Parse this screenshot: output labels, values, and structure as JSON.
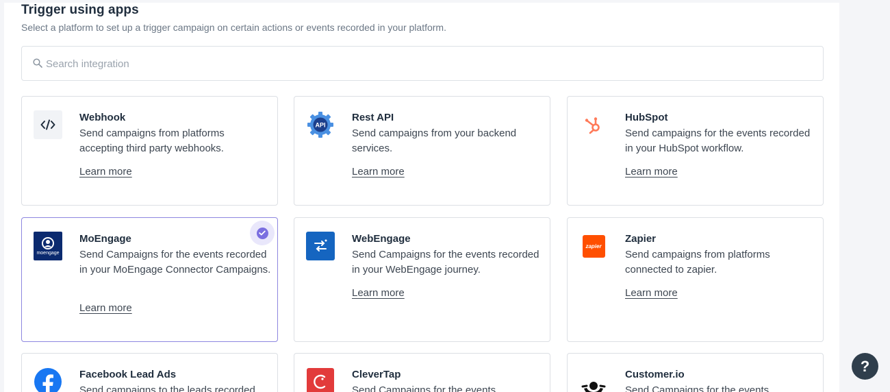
{
  "header": {
    "title": "Trigger using apps",
    "subtitle": "Select a platform to set up a trigger campaign on certain actions or events recorded in your platform."
  },
  "search": {
    "placeholder": "Search integration",
    "icon": "search-icon"
  },
  "cards": [
    {
      "name": "Webhook",
      "desc": "Send campaigns from platforms accepting third party webhooks.",
      "link": "Learn more",
      "icon": "code-icon",
      "selected": false
    },
    {
      "name": "Rest API",
      "desc": "Send campaigns from your backend services.",
      "link": "Learn more",
      "icon": "api-gear-icon",
      "selected": false
    },
    {
      "name": "HubSpot",
      "desc": "Send campaigns for the events recorded in your HubSpot workflow.",
      "link": "Learn more",
      "icon": "hubspot-icon",
      "selected": false
    },
    {
      "name": "MoEngage",
      "desc": "Send Campaigns for the events recorded in your MoEngage Connector Campaigns.",
      "link": "Learn more",
      "icon": "moengage-logo",
      "logo_text": "moengage",
      "selected": true
    },
    {
      "name": "WebEngage",
      "desc": "Send Campaigns for the events recorded in your WebEngage journey.",
      "link": "Learn more",
      "icon": "webengage-logo",
      "selected": false
    },
    {
      "name": "Zapier",
      "desc": "Send campaigns from platforms connected to zapier.",
      "link": "Learn more",
      "icon": "zapier-logo",
      "logo_text": "zapier",
      "selected": false
    },
    {
      "name": "Facebook Lead Ads",
      "desc": "Send campaigns to the leads recorded",
      "icon": "facebook-icon",
      "selected": false
    },
    {
      "name": "CleverTap",
      "desc": "Send Campaigns for the events",
      "icon": "clevertap-logo",
      "selected": false
    },
    {
      "name": "Customer.io",
      "desc": "Send Campaigns for the events",
      "icon": "customerio-logo",
      "selected": false
    }
  ],
  "help": {
    "label": "?"
  },
  "colors": {
    "selected_border": "#8d86e0",
    "check": "#7b6fe0",
    "hubspot": "#ff7a59",
    "webengage": "#1565c0",
    "zapier": "#ff4f00",
    "facebook": "#1877f2",
    "clevertap": "#e23b3b",
    "moengage": "#0b2a6f"
  }
}
